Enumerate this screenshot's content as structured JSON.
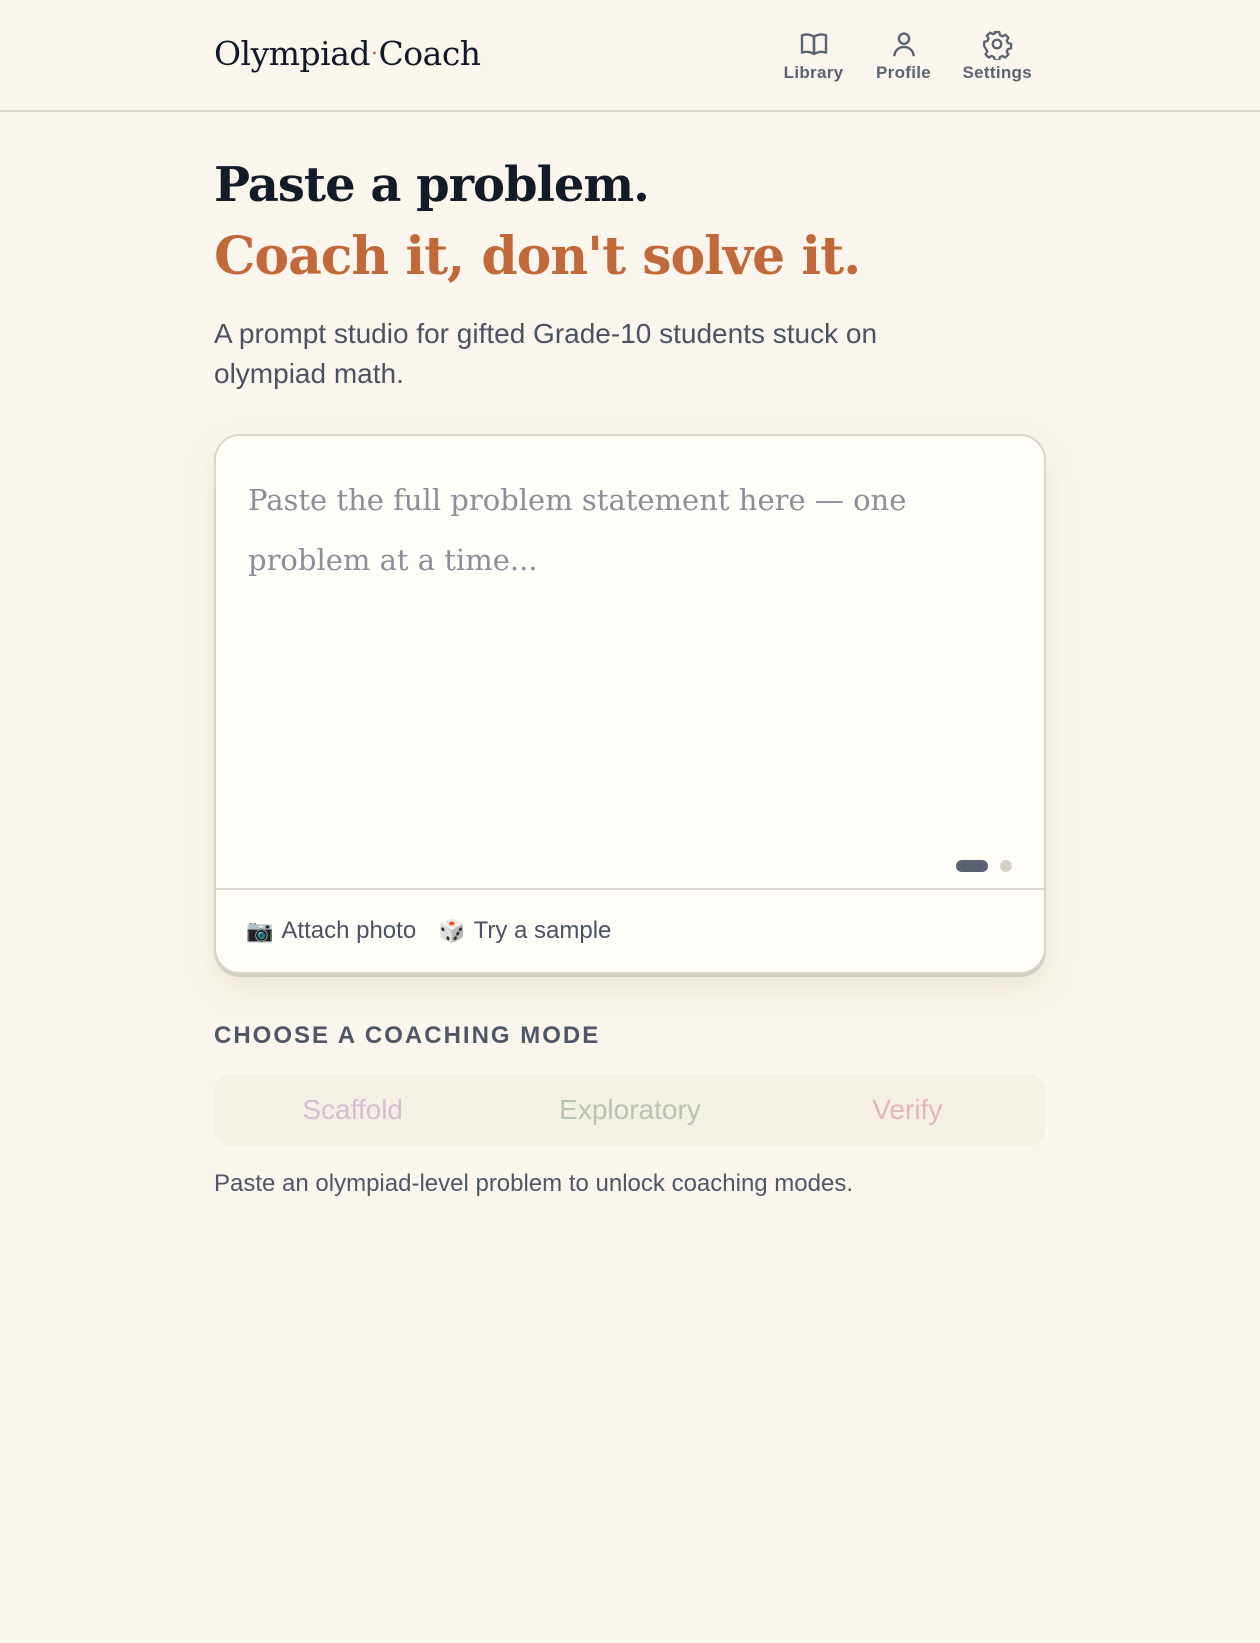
{
  "header": {
    "brand_part1": "Olympiad",
    "brand_dot": "·",
    "brand_part2": "Coach",
    "nav": [
      {
        "label": "Library",
        "icon": "book-icon"
      },
      {
        "label": "Profile",
        "icon": "user-icon"
      },
      {
        "label": "Settings",
        "icon": "gear-icon"
      }
    ]
  },
  "hero": {
    "title_line1": "Paste a problem.",
    "title_line2": "Coach it, don't solve it.",
    "subtitle": "A prompt studio for gifted Grade-10 students stuck on olympiad math."
  },
  "editor": {
    "placeholder": "Paste the full problem statement here — one problem at a time...",
    "value": "",
    "pager": {
      "active_page": 1,
      "total_pages": 2
    },
    "toolbar": {
      "attach_icon": "📷",
      "attach_label": "Attach photo",
      "sample_icon": "🎲",
      "sample_label": "Try a sample"
    }
  },
  "modes": {
    "section_label": "CHOOSE A COACHING MODE",
    "items": [
      {
        "label": "Scaffold",
        "color": "#d7bfd3"
      },
      {
        "label": "Exploratory",
        "color": "#b7c6ad"
      },
      {
        "label": "Verify",
        "color": "#e3b7b3"
      }
    ],
    "hint": "Paste an olympiad-level problem to unlock coaching modes."
  },
  "colors": {
    "background": "#faf6ed",
    "accent": "#c2693b",
    "text": "#131a28",
    "muted": "#4b5363"
  }
}
